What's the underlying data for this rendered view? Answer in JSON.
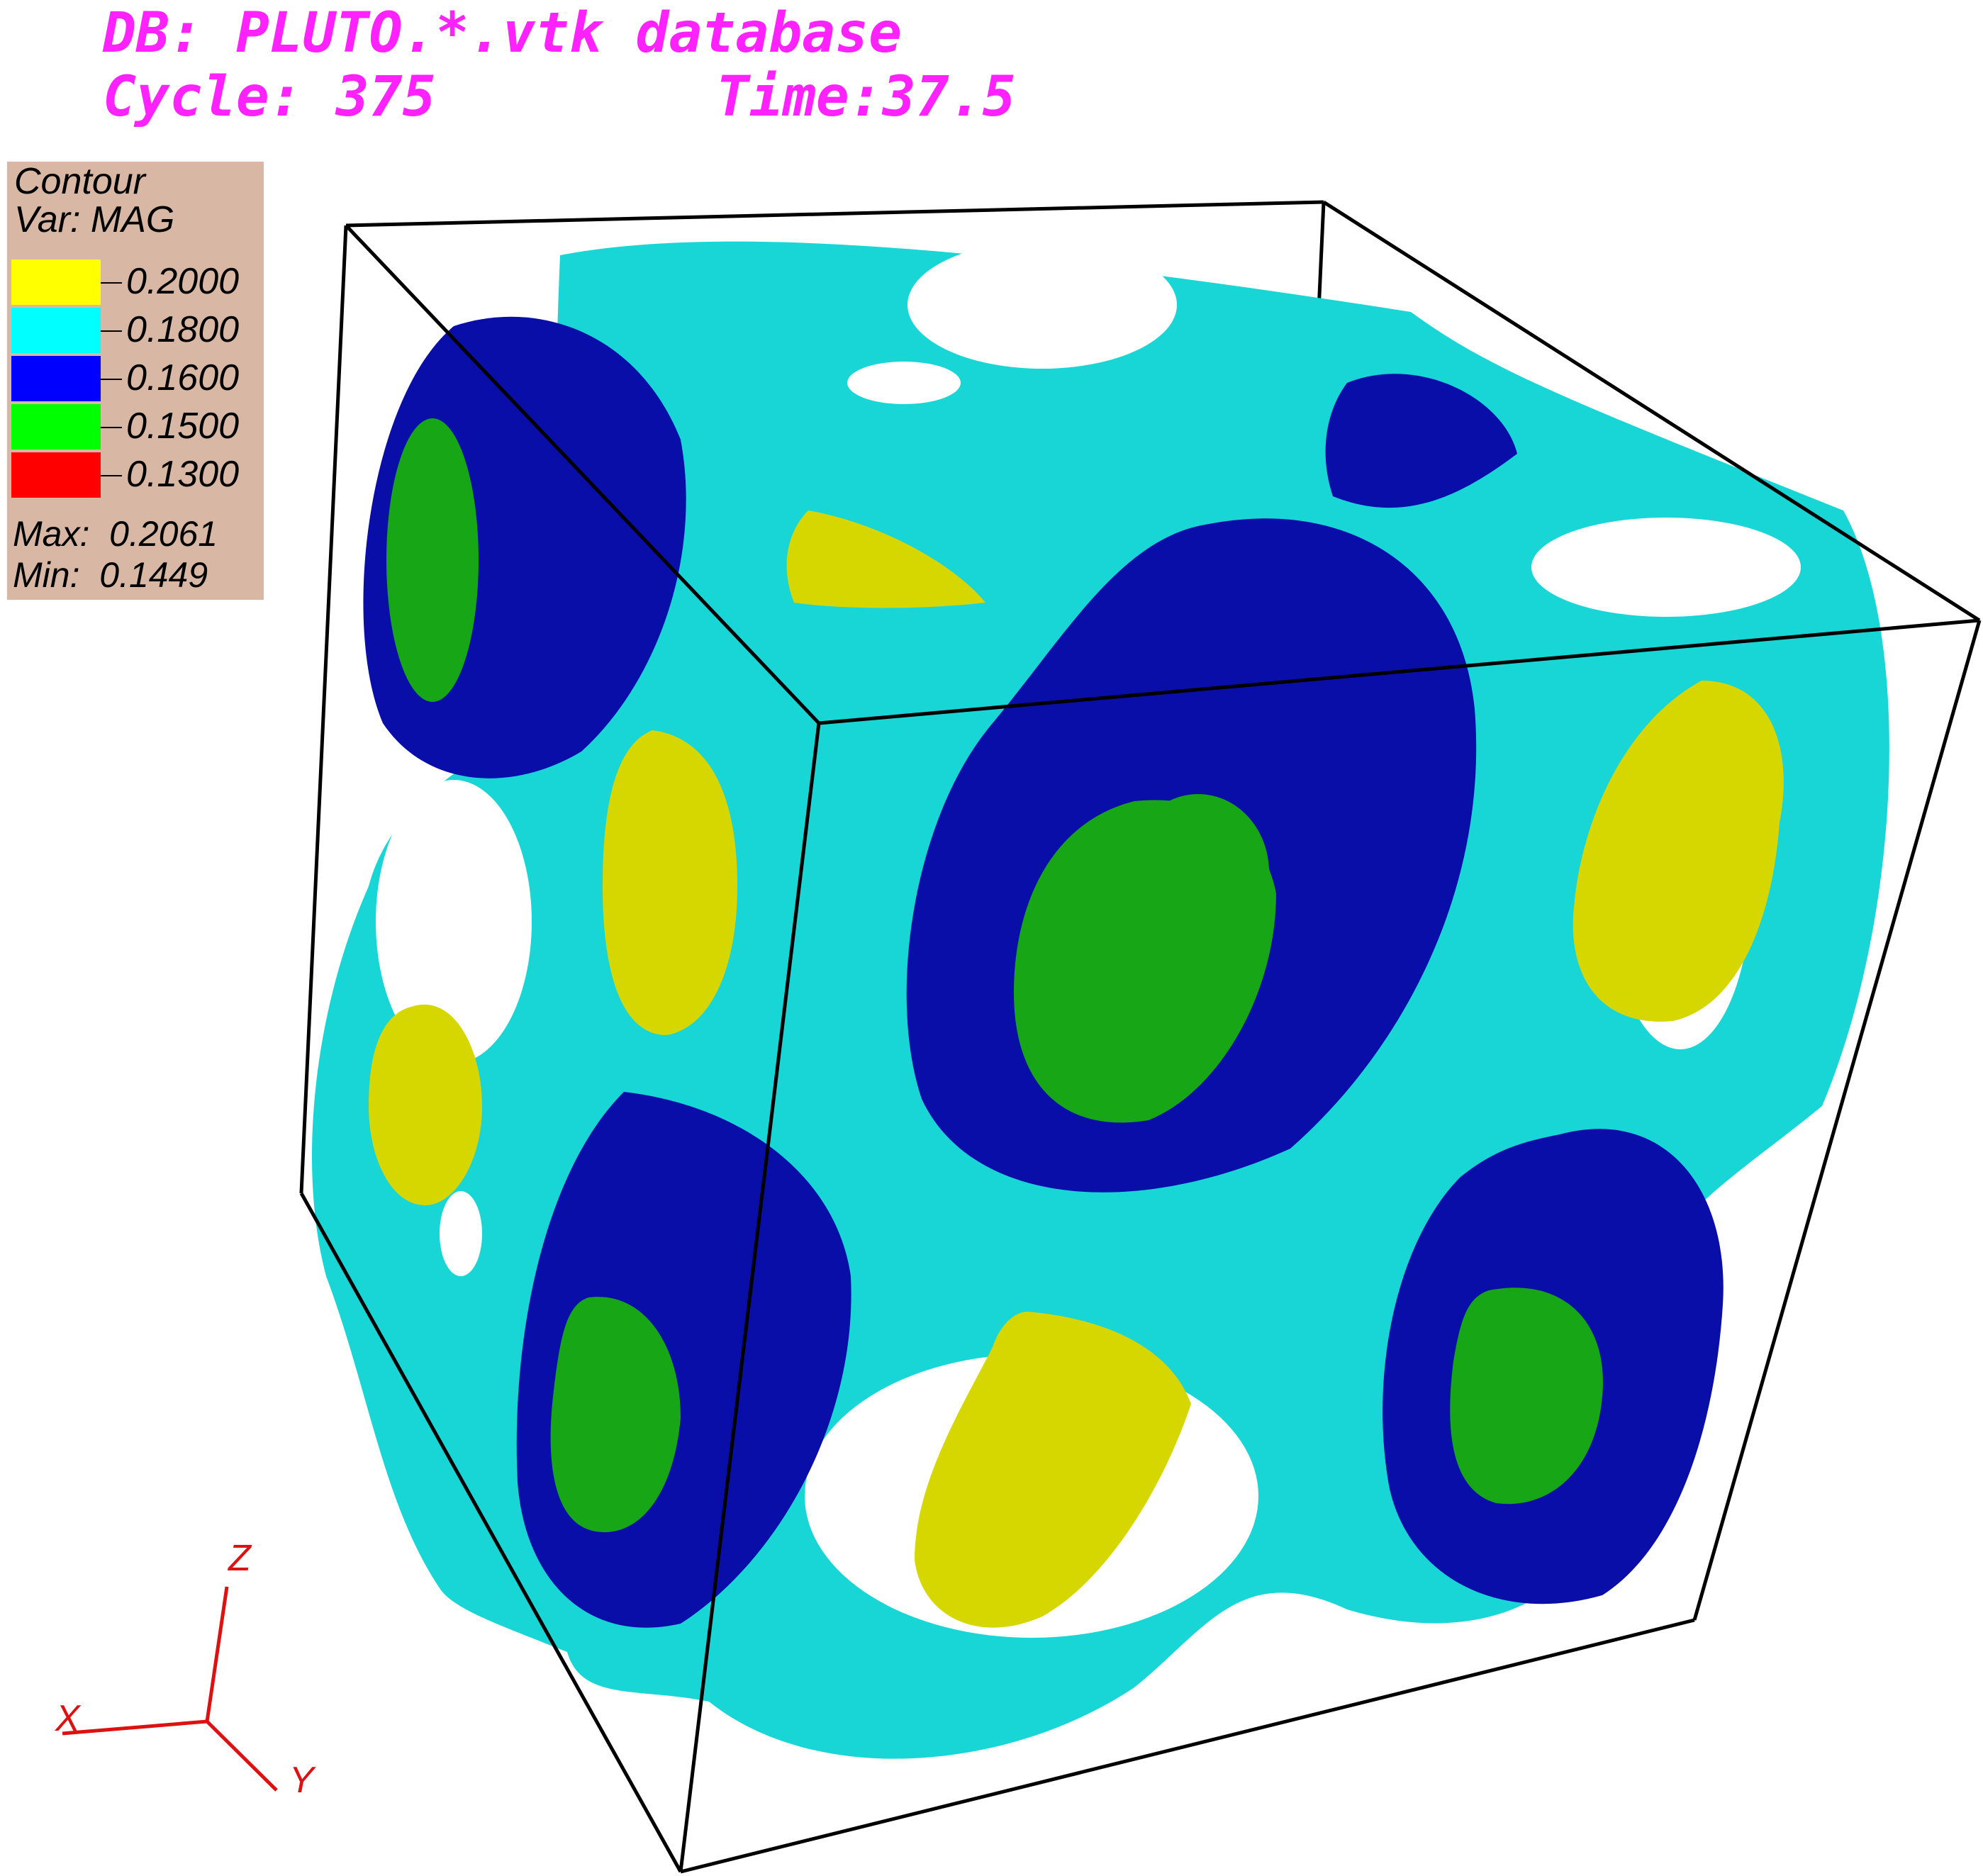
{
  "header": {
    "db_line": "DB: PLUTO.*.vtk database",
    "cycle_line": "Cycle: 375",
    "time_line": "Time:37.5"
  },
  "legend": {
    "title": "Contour",
    "var_label": "Var: MAG",
    "levels": [
      {
        "label": "0.2000",
        "color": "#ffff00"
      },
      {
        "label": "0.1800",
        "color": "#00ffff"
      },
      {
        "label": "0.1600",
        "color": "#0000ff"
      },
      {
        "label": "0.1500",
        "color": "#00ff00"
      },
      {
        "label": "0.1300",
        "color": "#ff0000"
      }
    ],
    "max_label": "Max:  0.2061",
    "min_label": "Min:  0.1449"
  },
  "axes": {
    "x_label": "X",
    "y_label": "Y",
    "z_label": "Z",
    "color": "#dd1111"
  },
  "surface_colors": {
    "cyan": "#19d6d6",
    "blue": "#0a0ea8",
    "green": "#16a616",
    "yellow": "#d6d600"
  }
}
